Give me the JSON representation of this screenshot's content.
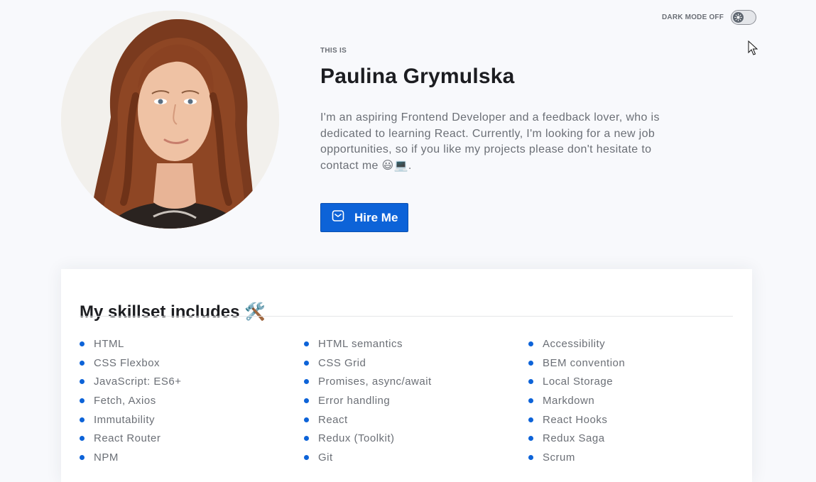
{
  "theme": {
    "accent": "#0d63d8",
    "background": "#f8f9fc",
    "text": "#1c1d21",
    "muted": "#6b6f76"
  },
  "dark_mode": {
    "label": "DARK MODE OFF",
    "enabled": false,
    "icon": "sun-icon"
  },
  "hero": {
    "eyebrow": "THIS IS",
    "name": "Paulina Grymulska",
    "bio": "I'm an aspiring Frontend Developer and a feedback lover, who is dedicated to learning React. Currently, I'm looking for a new job opportunities, so if you like my projects please don't hesitate to contact me 😃💻.",
    "hire_button": {
      "label": "Hire Me",
      "icon": "envelope-icon"
    }
  },
  "skills": {
    "title": "My skillset includes 🛠️",
    "columns": [
      [
        "HTML",
        "CSS Flexbox",
        "JavaScript: ES6+",
        "Fetch, Axios",
        "Immutability",
        "React Router",
        "NPM"
      ],
      [
        "HTML semantics",
        "CSS Grid",
        "Promises, async/await",
        "Error handling",
        "React",
        "Redux (Toolkit)",
        "Git"
      ],
      [
        "Accessibility",
        "BEM convention",
        "Local Storage",
        "Markdown",
        "React Hooks",
        "Redux Saga",
        "Scrum"
      ]
    ]
  }
}
